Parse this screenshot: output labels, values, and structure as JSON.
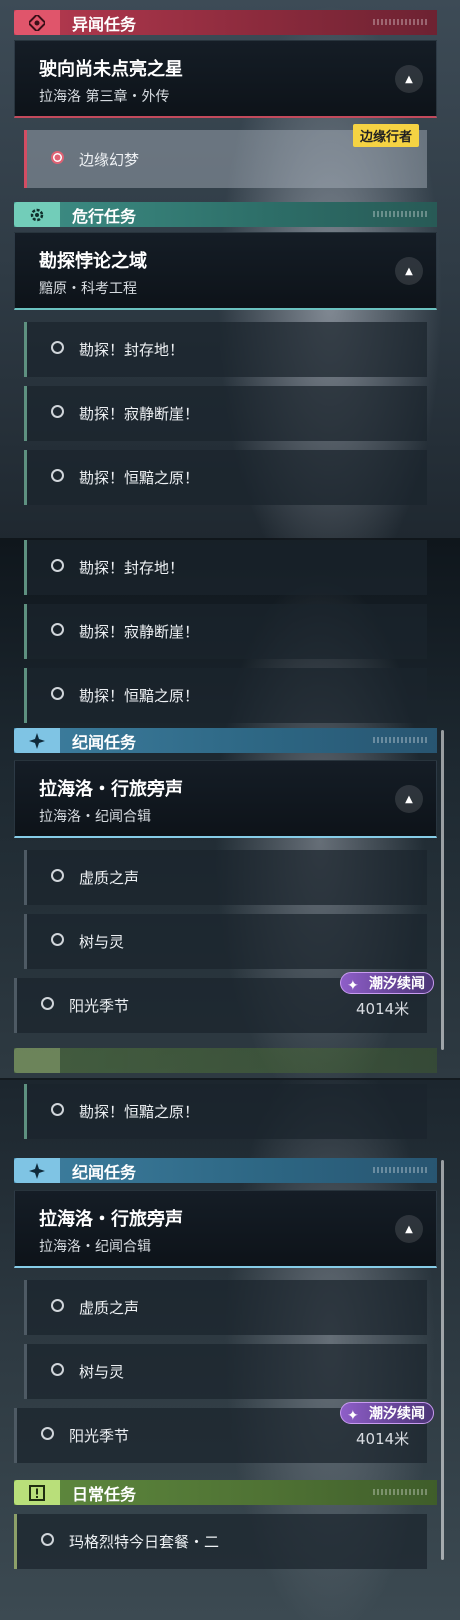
{
  "band1": {
    "special_quests": {
      "label": "异闻任务",
      "icon": "exotic-star-icon",
      "color": "#b63a50"
    },
    "special_card": {
      "title": "驶向尚未点亮之星",
      "subtitle": "拉海洛 第三章・外传"
    },
    "special_objective": {
      "label": "边缘幻梦",
      "badge": "边缘行者"
    },
    "danger_quests": {
      "label": "危行任务",
      "icon": "danger-gear-icon",
      "color": "#3e8f86"
    },
    "danger_card": {
      "title": "勘探悖论之域",
      "subtitle": "黯原・科考工程"
    },
    "danger_objectives": [
      "勘探！封存地！",
      "勘探！寂静断崖！",
      "勘探！恒黯之原！"
    ]
  },
  "band2": {
    "danger_objectives": [
      "勘探！封存地！",
      "勘探！寂静断崖！",
      "勘探！恒黯之原！"
    ],
    "chronicle_quests": {
      "label": "纪闻任务",
      "icon": "sparkle-icon",
      "color": "#3e7fa0"
    },
    "chronicle_card": {
      "title": "拉海洛・行旅旁声",
      "subtitle": "拉海洛・纪闻合辑"
    },
    "chronicle_objectives": [
      "虚质之声",
      "树与灵"
    ],
    "tidal_objective": {
      "label": "阳光季节",
      "tag": "潮汐续闻",
      "distance": "4014米"
    }
  },
  "band3": {
    "danger_objective": "勘探！恒黯之原！",
    "chronicle_quests": {
      "label": "纪闻任务",
      "icon": "sparkle-icon"
    },
    "chronicle_card": {
      "title": "拉海洛・行旅旁声",
      "subtitle": "拉海洛・纪闻合辑"
    },
    "chronicle_objectives": [
      "虚质之声",
      "树与灵"
    ],
    "tidal_objective": {
      "label": "阳光季节",
      "tag": "潮汐续闻",
      "distance": "4014米"
    },
    "daily_quests": {
      "label": "日常任务",
      "icon": "exclamation-icon",
      "color": "#5f8a3e"
    },
    "daily_objective": "玛格烈特今日套餐・二"
  }
}
